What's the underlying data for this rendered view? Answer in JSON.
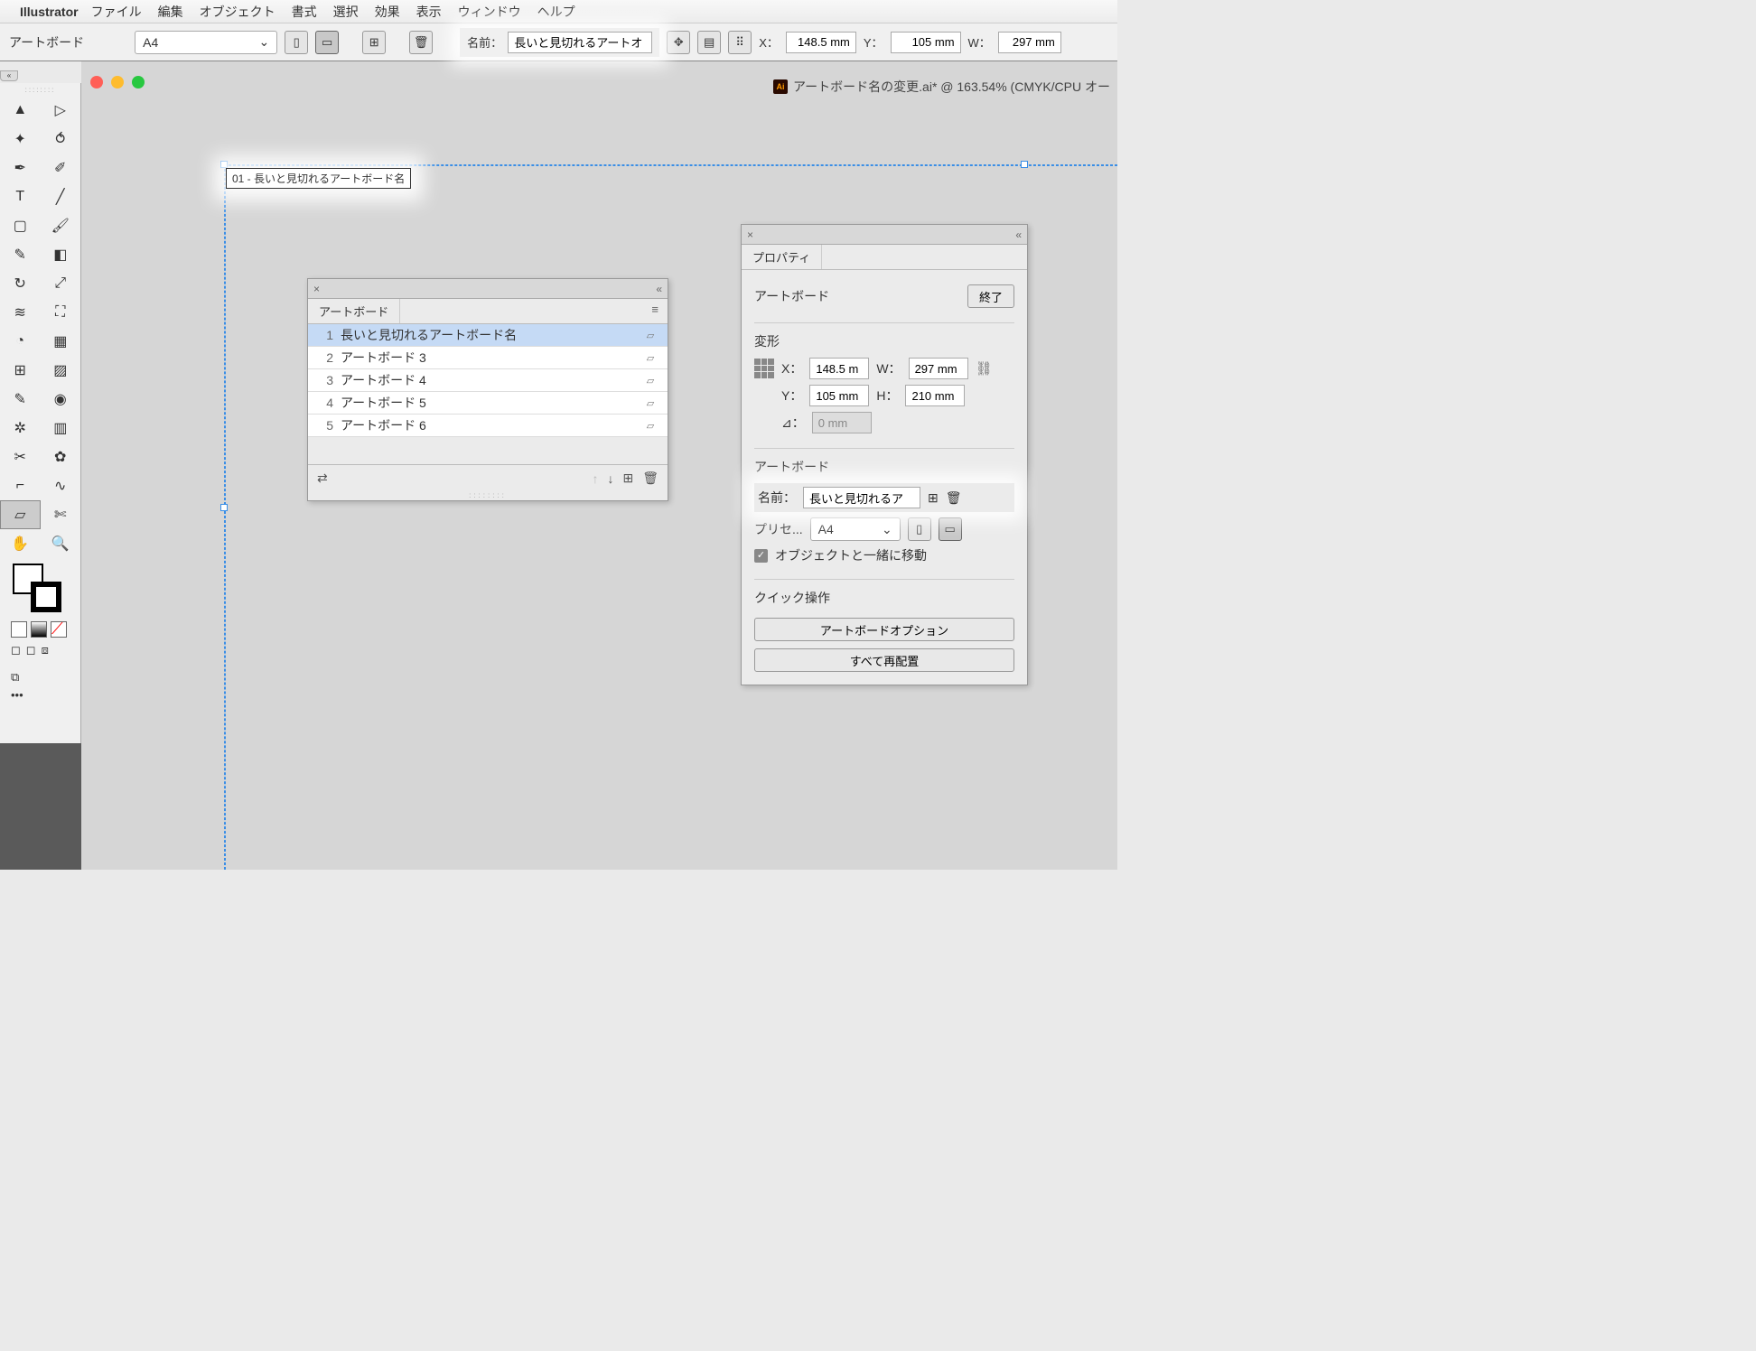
{
  "menubar": {
    "app": "Illustrator",
    "items": [
      "ファイル",
      "編集",
      "オブジェクト",
      "書式",
      "選択",
      "効果",
      "表示",
      "ウィンドウ",
      "ヘルプ"
    ]
  },
  "controlbar": {
    "mode_label": "アートボード",
    "preset": "A4",
    "name_label": "名前：",
    "name_value": "長いと見切れるアートオ",
    "x_label": "X：",
    "x_value": "148.5 mm",
    "y_label": "Y：",
    "y_value": "105 mm",
    "w_label": "W：",
    "w_value": "297 mm"
  },
  "document": {
    "title": "アートボード名の変更.ai* @ 163.54% (CMYK/CPU オー",
    "icon": "Ai"
  },
  "artboard_label": "01 - 長いと見切れるアートボード名",
  "artboards_panel": {
    "tab": "アートボード",
    "items": [
      {
        "num": "1",
        "name": "長いと見切れるアートボード名",
        "selected": true
      },
      {
        "num": "2",
        "name": "アートボード 3",
        "selected": false
      },
      {
        "num": "3",
        "name": "アートボード 4",
        "selected": false
      },
      {
        "num": "4",
        "name": "アートボード 5",
        "selected": false
      },
      {
        "num": "5",
        "name": "アートボード 6",
        "selected": false
      }
    ]
  },
  "properties": {
    "tab": "プロパティ",
    "section_artboard": "アートボード",
    "done_btn": "終了",
    "transform": "変形",
    "x_label": "X：",
    "x_value": "148.5 m",
    "y_label": "Y：",
    "y_value": "105 mm",
    "w_label": "W：",
    "w_value": "297 mm",
    "h_label": "H：",
    "h_value": "210 mm",
    "angle_label": "⊿：",
    "angle_value": "0 mm",
    "name_label": "名前：",
    "name_value": "長いと見切れるア",
    "preset_label": "プリセ...",
    "preset_value": "A4",
    "move_objects": "オブジェクトと一緒に移動",
    "quick_actions": "クイック操作",
    "options_btn": "アートボードオプション",
    "rearrange_btn": "すべて再配置"
  }
}
